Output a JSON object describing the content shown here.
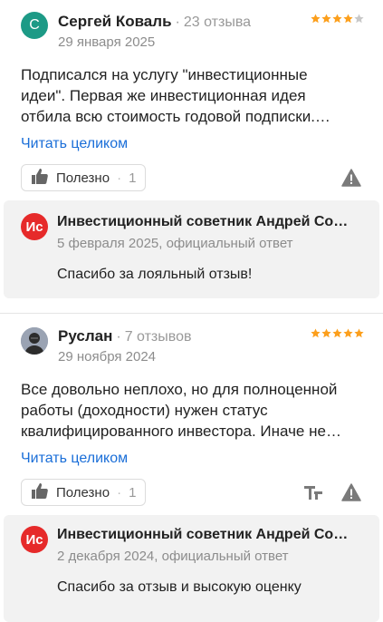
{
  "reviews": [
    {
      "avatar_letter": "С",
      "author": "Сергей Коваль",
      "reviews_count": "23 отзыва",
      "date": "29 января 2025",
      "rating": 4,
      "text_lines": [
        "Подписался на услугу \"инвестиционные",
        "идеи\". Первая же инвестиционная идея",
        "отбила всю стоимость годовой подписки.…"
      ],
      "read_more": "Читать целиком",
      "useful_label": "Полезно",
      "useful_count": "1",
      "reply": {
        "logo_text": "Ис",
        "author": "Инвестиционный советник Андрей Со…",
        "date": "5 февраля 2025, официальный ответ",
        "text": "Спасибо за лояльный отзыв!"
      }
    },
    {
      "author": "Руслан",
      "reviews_count": "7 отзывов",
      "date": "29 ноября 2024",
      "rating": 5,
      "text_lines": [
        "Все довольно неплохо, но для полноценной",
        "работы (доходности) нужен статус",
        "квалифицированного инвестора. Иначе не…"
      ],
      "read_more": "Читать целиком",
      "useful_label": "Полезно",
      "useful_count": "1",
      "reply": {
        "logo_text": "Ис",
        "author": "Инвестиционный советник Андрей Со…",
        "date": "2 декабря 2024, официальный ответ",
        "text": "Спасибо за отзыв и высокую оценку"
      }
    }
  ],
  "colors": {
    "star_filled": "#fc9f1c",
    "star_empty": "#c8c8c8",
    "link": "#1a6ed8",
    "brand_red": "#e62a2a",
    "avatar_teal": "#1d9a86"
  },
  "icons": {
    "useful": "thumbs-up-icon",
    "complaint": "warning-triangle-icon",
    "translate": "translate-icon"
  }
}
